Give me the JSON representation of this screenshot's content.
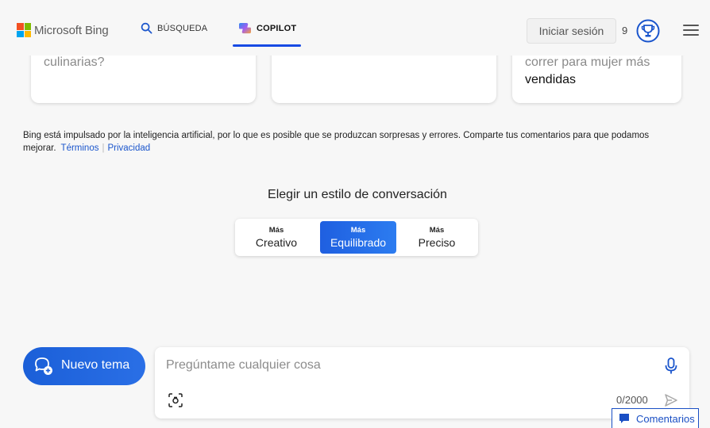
{
  "header": {
    "logo_text": "Microsoft Bing",
    "tab_search": "BÚSQUEDA",
    "tab_copilot": "COPILOT",
    "signin_label": "Iniciar sesión",
    "rewards_count": "9"
  },
  "cards": {
    "left_text": "culinarias?",
    "right_line1": "correr para mujer más",
    "right_line2": "vendidas"
  },
  "disclaimer": {
    "text": "Bing está impulsado por la inteligencia artificial, por lo que es posible que se produzcan sorpresas y errores. Comparte tus comentarios para que podamos mejorar.",
    "terms_label": "Términos",
    "privacy_label": "Privacidad"
  },
  "tone": {
    "title": "Elegir un estilo de conversación",
    "options": [
      {
        "prefix": "Más",
        "label": "Creativo"
      },
      {
        "prefix": "Más",
        "label": "Equilibrado"
      },
      {
        "prefix": "Más",
        "label": "Preciso"
      }
    ],
    "selected": "Equilibrado"
  },
  "new_topic_label": "Nuevo tema",
  "input": {
    "placeholder": "Pregúntame cualquier cosa",
    "value": "",
    "char_count": "0/2000"
  },
  "feedback_label": "Comentarios",
  "colors": {
    "accent": "#174ae4",
    "button_gradient_start": "#1b5fd8",
    "link": "#1a55cc"
  },
  "icons": {
    "search": "search-icon",
    "copilot": "copilot-logo-icon",
    "rewards": "trophy-icon",
    "menu": "hamburger-menu-icon",
    "new_topic": "chat-add-icon",
    "mic": "microphone-icon",
    "visual_search": "visual-search-icon",
    "send": "send-icon",
    "feedback": "feedback-icon"
  }
}
